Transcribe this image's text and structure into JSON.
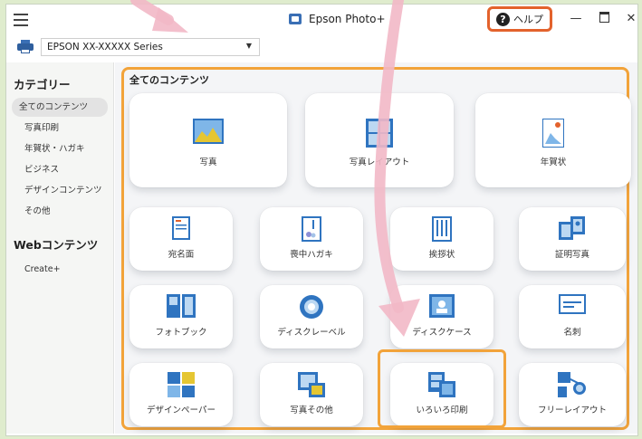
{
  "window": {
    "title": "Epson Photo+",
    "help_label": "ヘルプ",
    "minimize_glyph": "—",
    "close_glyph": "✕"
  },
  "printer": {
    "selected": "EPSON XX-XXXXX Series",
    "arrow_glyph": "▼"
  },
  "sidebar": {
    "categories_heading": "カテゴリー",
    "items": [
      {
        "label": "全てのコンテンツ",
        "selected": true
      },
      {
        "label": "写真印刷"
      },
      {
        "label": "年賀状・ハガキ"
      },
      {
        "label": "ビジネス"
      },
      {
        "label": "デザインコンテンツ"
      },
      {
        "label": "その他"
      }
    ],
    "web_heading": "Webコンテンツ",
    "web_items": [
      {
        "label": "Create+"
      }
    ]
  },
  "main": {
    "section_title": "全てのコンテンツ",
    "big_cards": [
      {
        "label": "写真",
        "icon": "photo-icon"
      },
      {
        "label": "写真レイアウト",
        "icon": "photo-layout-icon"
      },
      {
        "label": "年賀状",
        "icon": "new-year-card-icon"
      }
    ],
    "small_cards": [
      {
        "label": "宛名面",
        "icon": "address-side-icon"
      },
      {
        "label": "喪中ハガキ",
        "icon": "mourning-postcard-icon"
      },
      {
        "label": "挨拶状",
        "icon": "greeting-card-icon"
      },
      {
        "label": "証明写真",
        "icon": "id-photo-icon"
      },
      {
        "label": "フォトブック",
        "icon": "photobook-icon"
      },
      {
        "label": "ディスクレーベル",
        "icon": "disc-label-icon"
      },
      {
        "label": "ディスクケース",
        "icon": "disc-case-icon"
      },
      {
        "label": "名刺",
        "icon": "business-card-icon"
      },
      {
        "label": "デザインペーパー",
        "icon": "design-paper-icon"
      },
      {
        "label": "写真その他",
        "icon": "photo-other-icon"
      },
      {
        "label": "いろいろ印刷",
        "icon": "various-print-icon"
      },
      {
        "label": "フリーレイアウト",
        "icon": "free-layout-icon"
      }
    ]
  },
  "colors": {
    "highlight_orange": "#f2a33a",
    "help_outline": "#e3622c",
    "annotation_arrow_pink": "#f2b8c6",
    "accent_blue": "#3a6fb5"
  }
}
